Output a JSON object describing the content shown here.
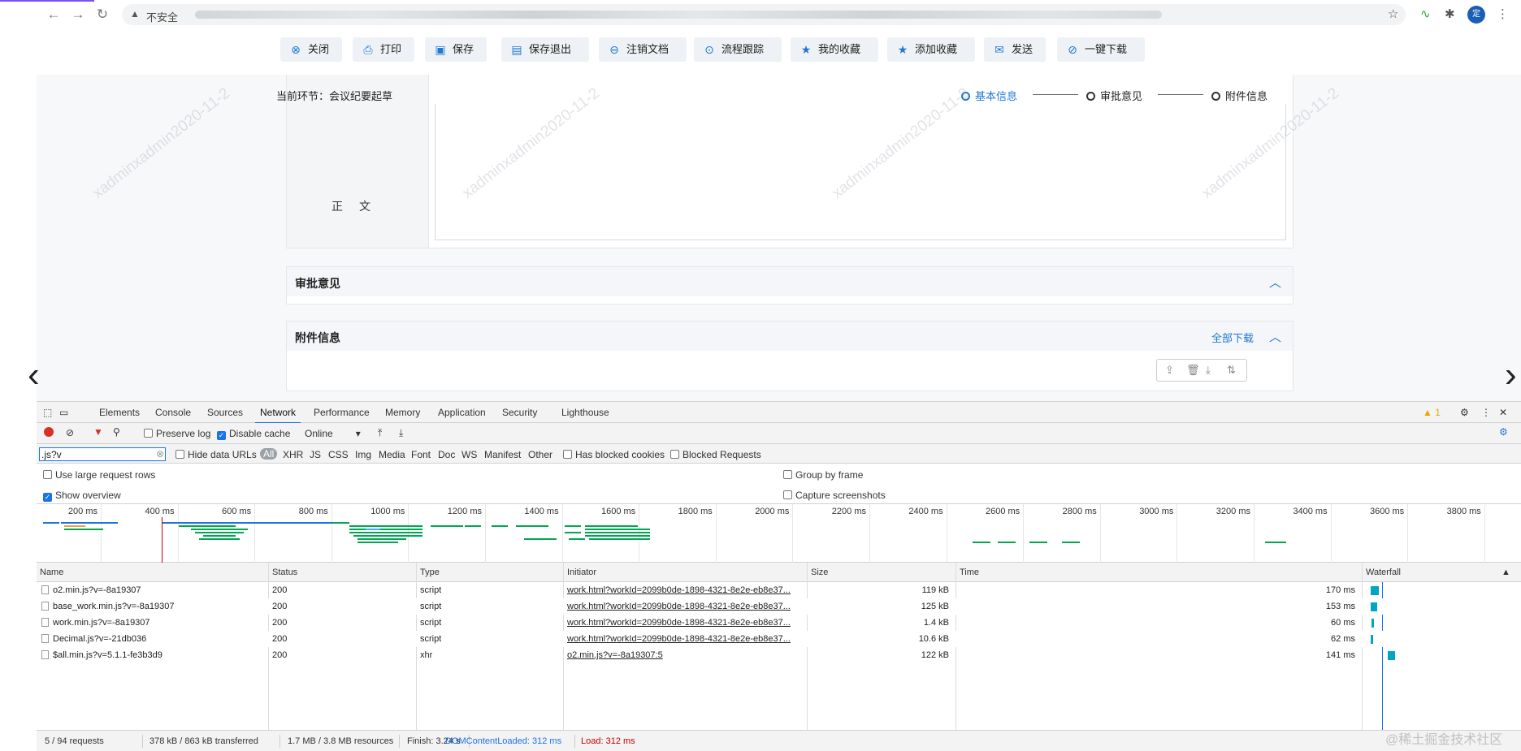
{
  "browser": {
    "insecure_label": "不安全",
    "avatar_label": "定"
  },
  "toolbar": {
    "buttons": [
      {
        "label": "关闭",
        "icon": "close-circle-icon"
      },
      {
        "label": "打印",
        "icon": "printer-icon"
      },
      {
        "label": "保存",
        "icon": "floppy-disk-icon"
      },
      {
        "label": "保存退出",
        "icon": "save-exit-icon"
      },
      {
        "label": "注销文档",
        "icon": "minus-circle-icon"
      },
      {
        "label": "流程跟踪",
        "icon": "target-icon"
      },
      {
        "label": "我的收藏",
        "icon": "star-icon"
      },
      {
        "label": "添加收藏",
        "icon": "star-add-icon"
      },
      {
        "label": "发送",
        "icon": "send-icon"
      },
      {
        "label": "一键下载",
        "icon": "download-link-icon"
      }
    ]
  },
  "workflow": {
    "current_step": "当前环节：会议纪要起草",
    "steps": [
      {
        "label": "基本信息",
        "active": true
      },
      {
        "label": "审批意见",
        "active": false
      },
      {
        "label": "附件信息",
        "active": false
      }
    ]
  },
  "form": {
    "body_label": "正文"
  },
  "panels": {
    "approval_title": "审批意见",
    "attachment_title": "附件信息",
    "download_all": "全部下载"
  },
  "watermark_text": "xadminxadmin2020-11-2",
  "devtools": {
    "tabs": [
      "Elements",
      "Console",
      "Sources",
      "Network",
      "Performance",
      "Memory",
      "Application",
      "Security",
      "Lighthouse"
    ],
    "active_tab": "Network",
    "warning_count": "1",
    "preserve_log": "Preserve log",
    "disable_cache": "Disable cache",
    "throttle": "Online",
    "filter_value": ".js?v",
    "hide_data_urls": "Hide data URLs",
    "type_filters": [
      "All",
      "XHR",
      "JS",
      "CSS",
      "Img",
      "Media",
      "Font",
      "Doc",
      "WS",
      "Manifest",
      "Other"
    ],
    "has_blocked_cookies": "Has blocked cookies",
    "blocked_requests": "Blocked Requests",
    "use_large_rows": "Use large request rows",
    "show_overview": "Show overview",
    "group_by_frame": "Group by frame",
    "capture_screenshots": "Capture screenshots",
    "overview_ticks": [
      "200 ms",
      "400 ms",
      "600 ms",
      "800 ms",
      "1000 ms",
      "1200 ms",
      "1400 ms",
      "1600 ms",
      "1800 ms",
      "2000 ms",
      "2200 ms",
      "2400 ms",
      "2600 ms",
      "2800 ms",
      "3000 ms",
      "3200 ms",
      "3400 ms",
      "3600 ms",
      "3800 ms"
    ],
    "columns": [
      "Name",
      "Status",
      "Type",
      "Initiator",
      "Size",
      "Time",
      "Waterfall"
    ],
    "requests": [
      {
        "name": "o2.min.js?v=-8a19307",
        "status": "200",
        "type": "script",
        "initiator": "work.html?workId=2099b0de-1898-4321-8e2e-eb8e37...",
        "size": "119 kB",
        "time": "170 ms"
      },
      {
        "name": "base_work.min.js?v=-8a19307",
        "status": "200",
        "type": "script",
        "initiator": "work.html?workId=2099b0de-1898-4321-8e2e-eb8e37...",
        "size": "125 kB",
        "time": "153 ms"
      },
      {
        "name": "work.min.js?v=-8a19307",
        "status": "200",
        "type": "script",
        "initiator": "work.html?workId=2099b0de-1898-4321-8e2e-eb8e37...",
        "size": "1.4 kB",
        "time": "60 ms"
      },
      {
        "name": "Decimal.js?v=-21db036",
        "status": "200",
        "type": "script",
        "initiator": "work.html?workId=2099b0de-1898-4321-8e2e-eb8e37...",
        "size": "10.6 kB",
        "time": "62 ms"
      },
      {
        "name": "$all.min.js?v=5.1.1-fe3b3d9",
        "status": "200",
        "type": "xhr",
        "initiator": "o2.min.js?v=-8a19307:5",
        "size": "122 kB",
        "time": "141 ms"
      }
    ],
    "status": {
      "requests": "5 / 94 requests",
      "transferred": "378 kB / 863 kB transferred",
      "resources": "1.7 MB / 3.8 MB resources",
      "finish": "Finish: 3.24 s",
      "dom_loaded": "DOMContentLoaded: 312 ms",
      "load": "Load: 312 ms"
    }
  },
  "credit": "@稀土掘金技术社区",
  "colors": {
    "accent": "#1f78d1",
    "devtools_blue": "#1a73e8",
    "load_red": "#c80000",
    "waterfall_bar": "#00a6c0"
  }
}
